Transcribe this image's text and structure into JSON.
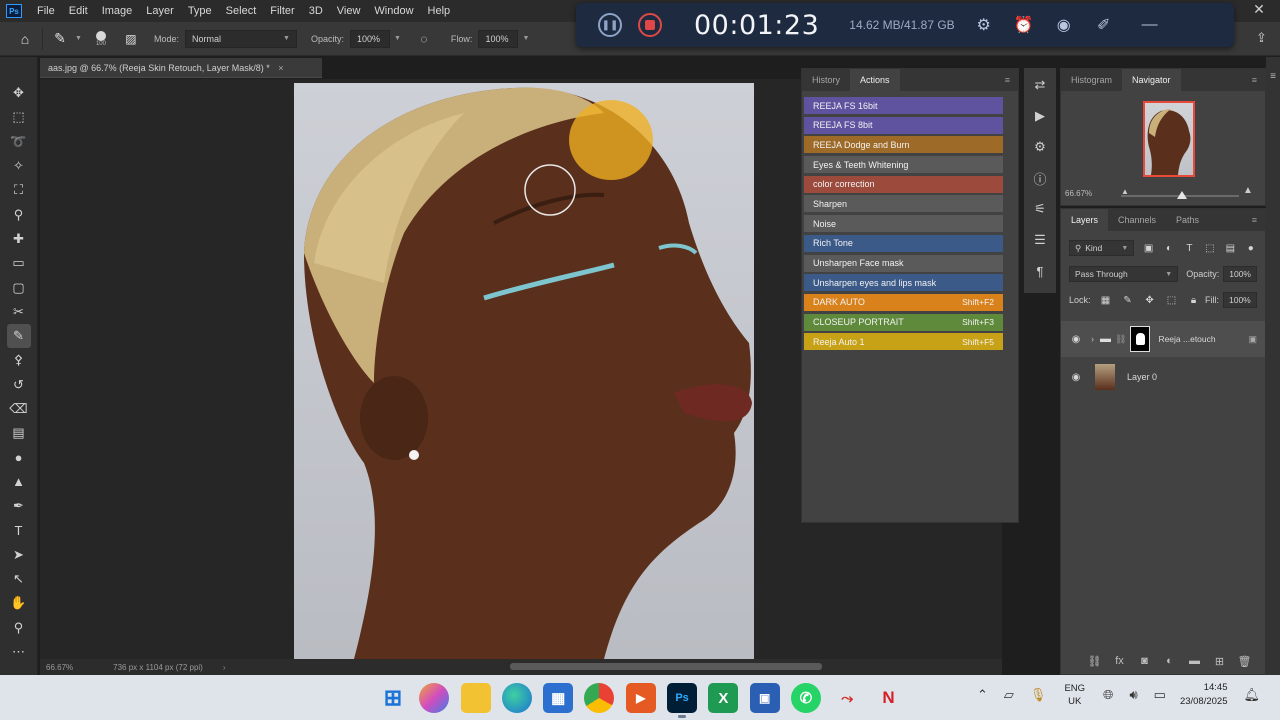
{
  "app": {
    "logo_text": "Ps",
    "menu": [
      "File",
      "Edit",
      "Image",
      "Layer",
      "Type",
      "Select",
      "Filter",
      "3D",
      "View",
      "Window",
      "Help"
    ]
  },
  "options_bar": {
    "brush_size": "100",
    "mode_label": "Mode:",
    "mode_value": "Normal",
    "opacity_label": "Opacity:",
    "opacity_value": "100%",
    "flow_label": "Flow:",
    "flow_value": "100%"
  },
  "recorder": {
    "time": "00:01:23",
    "size": "14.62 MB/41.87 GB"
  },
  "document": {
    "tab_title": "aas.jpg @ 66.7% (Reeja Skin Retouch, Layer Mask/8) *",
    "status_zoom": "66.67%",
    "status_dims": "736 px x 1104 px (72 ppi)"
  },
  "actions_panel": {
    "tabs": [
      "History",
      "Actions"
    ],
    "active_tab": "Actions",
    "items": [
      {
        "label": "REEJA FS 16bit",
        "shortcut": "",
        "color": "#5f53a0"
      },
      {
        "label": "REEJA FS 8bit",
        "shortcut": "",
        "color": "#5f53a0"
      },
      {
        "label": "REEJA Dodge and Burn",
        "shortcut": "",
        "color": "#9e6a28"
      },
      {
        "label": "Eyes & Teeth Whitening",
        "shortcut": "",
        "color": "#5a5a5a"
      },
      {
        "label": "color correction",
        "shortcut": "",
        "color": "#9b4a3c"
      },
      {
        "label": "Sharpen",
        "shortcut": "",
        "color": "#5a5a5a"
      },
      {
        "label": "Noise",
        "shortcut": "",
        "color": "#5a5a5a"
      },
      {
        "label": "Rich Tone",
        "shortcut": "",
        "color": "#3c5a88"
      },
      {
        "label": "Unsharpen Face mask",
        "shortcut": "",
        "color": "#5a5a5a"
      },
      {
        "label": "Unsharpen eyes and lips mask",
        "shortcut": "",
        "color": "#3c5a88"
      },
      {
        "label": "DARK AUTO",
        "shortcut": "Shift+F2",
        "color": "#d9821c"
      },
      {
        "label": "CLOSEUP PORTRAIT",
        "shortcut": "Shift+F3",
        "color": "#5f8a3c"
      },
      {
        "label": "Reeja Auto 1",
        "shortcut": "Shift+F5",
        "color": "#c8a216"
      }
    ]
  },
  "navigator_panel": {
    "tabs": [
      "Histogram",
      "Navigator"
    ],
    "active_tab": "Navigator",
    "zoom": "66.67%"
  },
  "layers_panel": {
    "tabs": [
      "Layers",
      "Channels",
      "Paths"
    ],
    "active_tab": "Layers",
    "filter_kind": "Kind",
    "blend_mode": "Pass Through",
    "opacity_label": "Opacity:",
    "opacity_value": "100%",
    "lock_label": "Lock:",
    "fill_label": "Fill:",
    "fill_value": "100%",
    "layers": [
      {
        "name": "Reeja ...etouch",
        "type": "group",
        "selected": true
      },
      {
        "name": "Layer 0",
        "type": "image",
        "selected": false
      }
    ]
  },
  "taskbar": {
    "lang_top": "ENG",
    "lang_bottom": "UK",
    "time": "14:45",
    "date": "23/08/2025"
  },
  "colors": {
    "accent": "#31a8ff",
    "recorder_bg": "#1d2a3f",
    "stop_red": "#e04848"
  }
}
